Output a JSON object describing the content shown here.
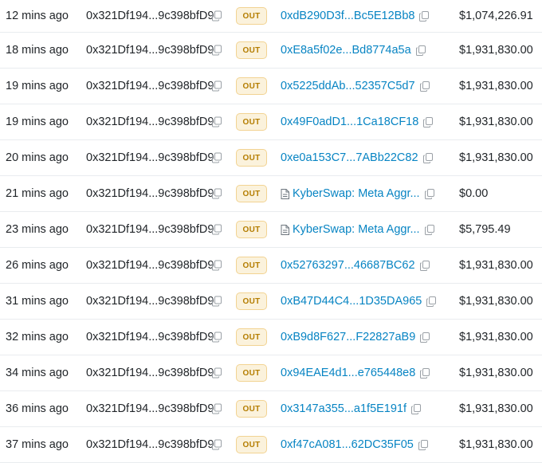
{
  "badge_label": "OUT",
  "rows": [
    {
      "age": "12 mins ago",
      "from": "0x321Df194...9c398bfD9",
      "to": "0xdB290D3f...Bc5E12Bb8",
      "to_is_contract": false,
      "amount": "$1,074,226.91"
    },
    {
      "age": "18 mins ago",
      "from": "0x321Df194...9c398bfD9",
      "to": "0xE8a5f02e...Bd8774a5a",
      "to_is_contract": false,
      "amount": "$1,931,830.00"
    },
    {
      "age": "19 mins ago",
      "from": "0x321Df194...9c398bfD9",
      "to": "0x5225ddAb...52357C5d7",
      "to_is_contract": false,
      "amount": "$1,931,830.00"
    },
    {
      "age": "19 mins ago",
      "from": "0x321Df194...9c398bfD9",
      "to": "0x49F0adD1...1Ca18CF18",
      "to_is_contract": false,
      "amount": "$1,931,830.00"
    },
    {
      "age": "20 mins ago",
      "from": "0x321Df194...9c398bfD9",
      "to": "0xe0a153C7...7ABb22C82",
      "to_is_contract": false,
      "amount": "$1,931,830.00"
    },
    {
      "age": "21 mins ago",
      "from": "0x321Df194...9c398bfD9",
      "to": "KyberSwap: Meta Aggr...",
      "to_is_contract": true,
      "amount": "$0.00"
    },
    {
      "age": "23 mins ago",
      "from": "0x321Df194...9c398bfD9",
      "to": "KyberSwap: Meta Aggr...",
      "to_is_contract": true,
      "amount": "$5,795.49"
    },
    {
      "age": "26 mins ago",
      "from": "0x321Df194...9c398bfD9",
      "to": "0x52763297...46687BC62",
      "to_is_contract": false,
      "amount": "$1,931,830.00"
    },
    {
      "age": "31 mins ago",
      "from": "0x321Df194...9c398bfD9",
      "to": "0xB47D44C4...1D35DA965",
      "to_is_contract": false,
      "amount": "$1,931,830.00"
    },
    {
      "age": "32 mins ago",
      "from": "0x321Df194...9c398bfD9",
      "to": "0xB9d8F627...F22827aB9",
      "to_is_contract": false,
      "amount": "$1,931,830.00"
    },
    {
      "age": "34 mins ago",
      "from": "0x321Df194...9c398bfD9",
      "to": "0x94EAE4d1...e765448e8",
      "to_is_contract": false,
      "amount": "$1,931,830.00"
    },
    {
      "age": "36 mins ago",
      "from": "0x321Df194...9c398bfD9",
      "to": "0x3147a355...a1f5E191f",
      "to_is_contract": false,
      "amount": "$1,931,830.00"
    },
    {
      "age": "37 mins ago",
      "from": "0x321Df194...9c398bfD9",
      "to": "0xf47cA081...62DC35F05",
      "to_is_contract": false,
      "amount": "$1,931,830.00"
    }
  ],
  "colors": {
    "link": "#0784c3",
    "badge_bg": "#fbf2dc",
    "badge_border": "#f2d392",
    "badge_text": "#b47d00",
    "divider": "#e9ecef"
  },
  "icons": {
    "copy": "copy-icon",
    "contract": "document-icon"
  }
}
